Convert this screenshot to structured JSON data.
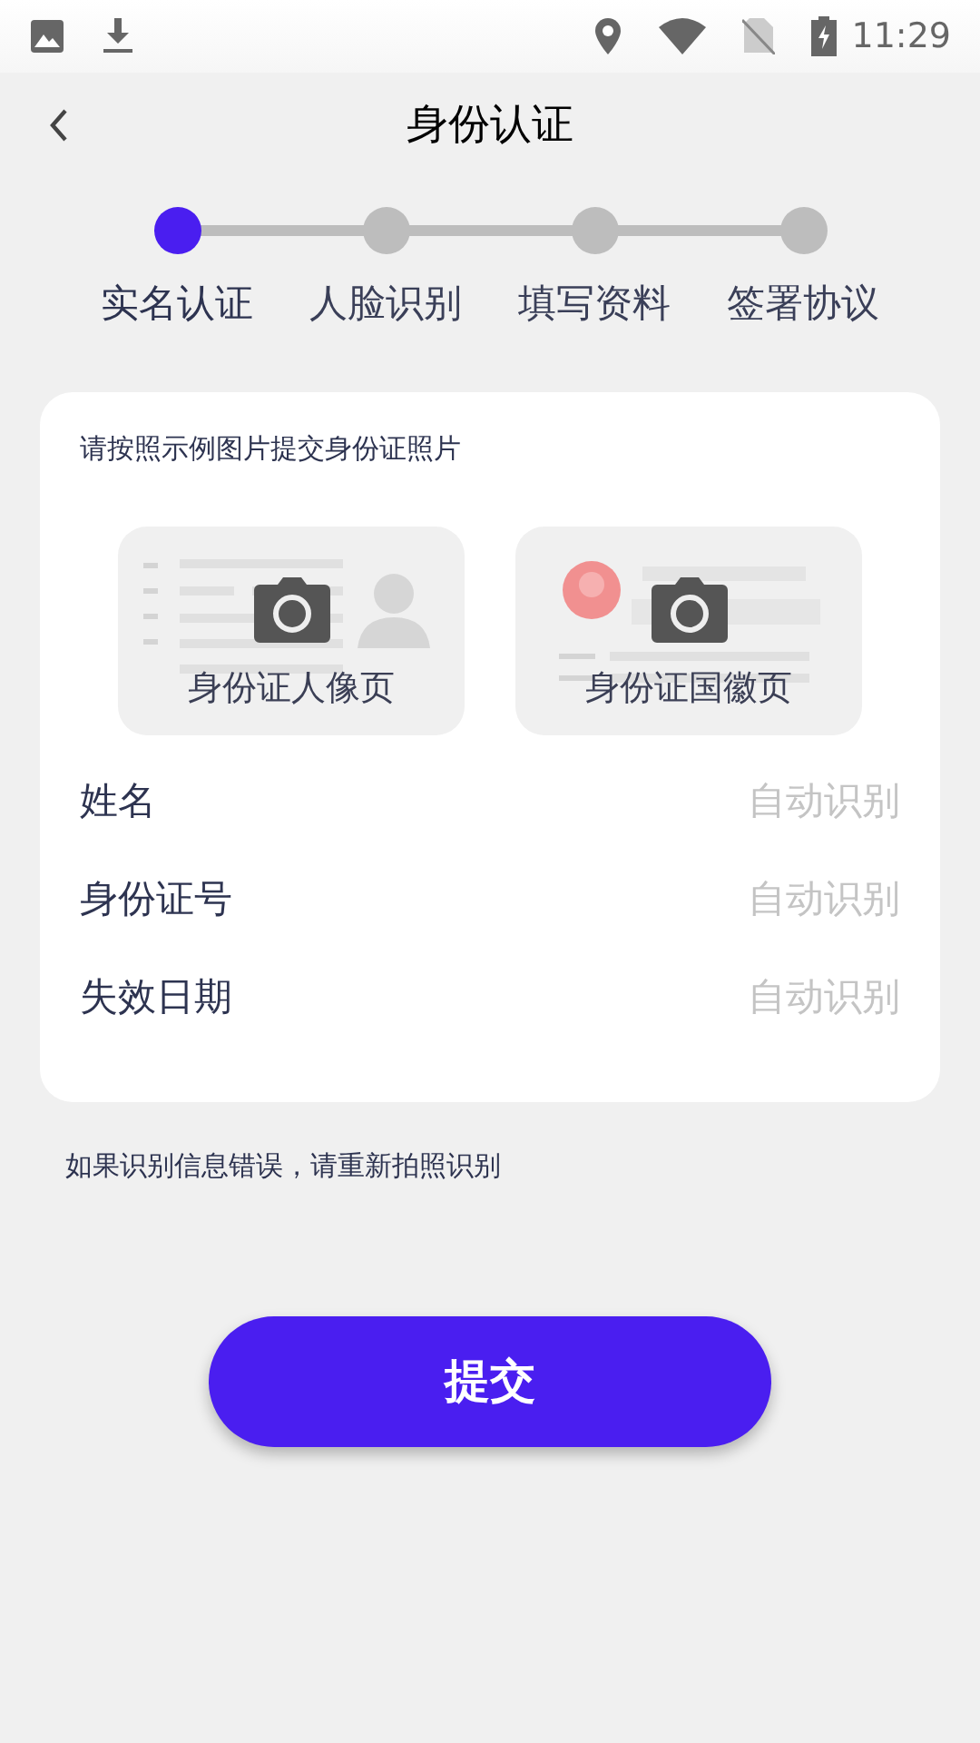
{
  "status_bar": {
    "time": "11:29"
  },
  "header": {
    "title": "身份认证"
  },
  "steps": [
    {
      "label": "实名认证",
      "selected": true
    },
    {
      "label": "人脸识别",
      "selected": false
    },
    {
      "label": "填写资料",
      "selected": false
    },
    {
      "label": "签署协议",
      "selected": false
    }
  ],
  "card": {
    "instruction": "请按照示例图片提交身份证照片",
    "uploads": [
      {
        "kind": "portrait",
        "label": "身份证人像页"
      },
      {
        "kind": "emblem",
        "label": "身份证国徽页"
      }
    ],
    "fields": [
      {
        "label": "姓名",
        "placeholder": "自动识别"
      },
      {
        "label": "身份证号",
        "placeholder": "自动识别"
      },
      {
        "label": "失效日期",
        "placeholder": "自动识别"
      }
    ]
  },
  "note": "如果识别信息错误，请重新拍照识别",
  "submit_button": "提交"
}
